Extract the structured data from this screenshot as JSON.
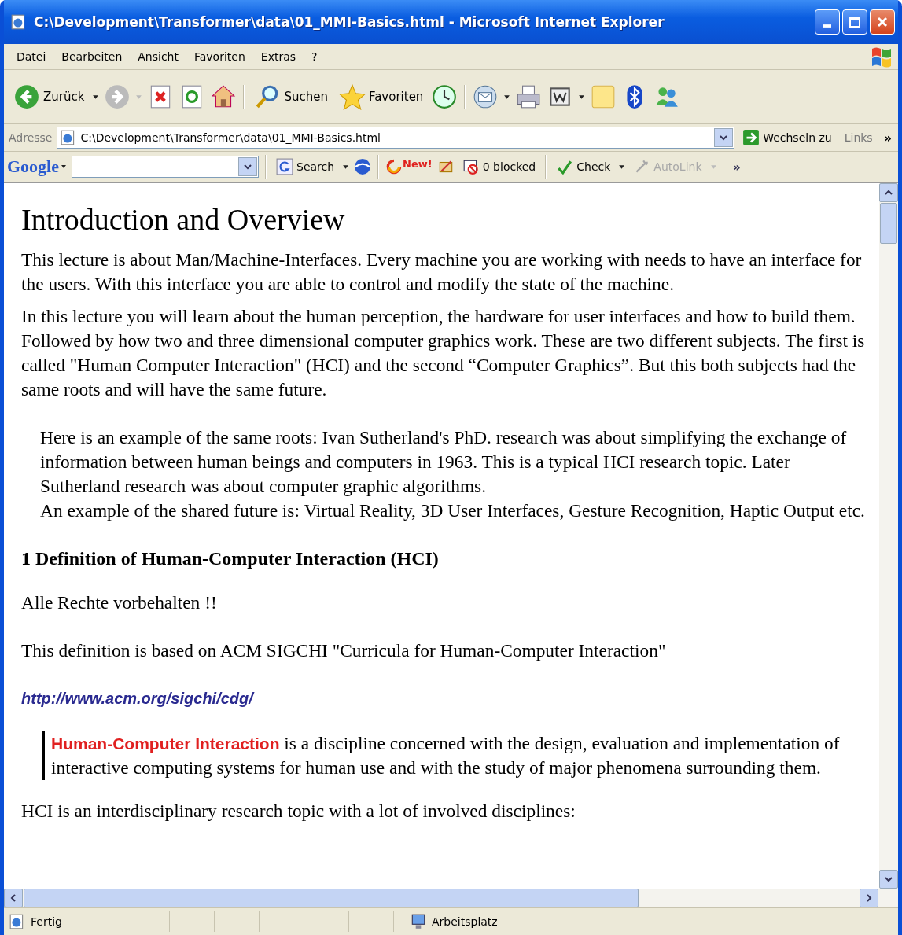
{
  "window": {
    "title": "C:\\Development\\Transformer\\data\\01_MMI-Basics.html - Microsoft Internet Explorer"
  },
  "menu": [
    "Datei",
    "Bearbeiten",
    "Ansicht",
    "Favoriten",
    "Extras",
    "?"
  ],
  "toolbar": {
    "back": "Zurück",
    "search": "Suchen",
    "favorites": "Favoriten"
  },
  "address": {
    "label": "Adresse",
    "value": "C:\\Development\\Transformer\\data\\01_MMI-Basics.html",
    "go": "Wechseln zu",
    "links": "Links",
    "more": "»"
  },
  "google": {
    "brand": "Google",
    "search": "Search",
    "new_badge": "New!",
    "blocked": "0 blocked",
    "check": "Check",
    "autolink": "AutoLink",
    "autolink_disabled": true,
    "more": "»"
  },
  "page": {
    "heading": "Introduction and Overview",
    "intro": [
      "This lecture is about Man/Machine-Interfaces. Every machine you are working with needs to have an interface for the users. With this interface you are able to control and modify the state of the machine.",
      "In this lecture you will learn about the human perception, the hardware for user interfaces and how to build them. Followed by how two and three dimensional computer graphics work. These are two different subjects. The first is called \"Human Computer Interaction\" (HCI) and the second “Computer Graphics”. But this both subjects had the same roots and will have the same future."
    ],
    "example": [
      "Here is an example of the same roots: Ivan Sutherland's PhD. research was about simplifying the exchange of information between human beings and computers in 1963. This is a typical HCI research topic. Later Sutherland research was about computer graphic algorithms.",
      "An example of the shared future is: Virtual Reality, 3D User Interfaces, Gesture Recognition, Haptic Output etc."
    ],
    "section_heading": "1 Definition of Human-Computer Interaction (HCI)",
    "notice": "Alle Rechte vorbehalten !!",
    "source": "This definition is based on ACM SIGCHI \"Curricula for Human-Computer Interaction\"",
    "link": "http://www.acm.org/sigchi/cdg/",
    "quote": {
      "term": "Human-Computer Interaction",
      "text": " is a discipline concerned with the design, evaluation and implementation of interactive computing systems for human use and with the study of major phenomena surrounding them."
    },
    "last_line": "HCI is an interdisciplinary research topic with a lot of involved disciplines:"
  },
  "status": {
    "text": "Fertig",
    "zone": "Arbeitsplatz"
  }
}
